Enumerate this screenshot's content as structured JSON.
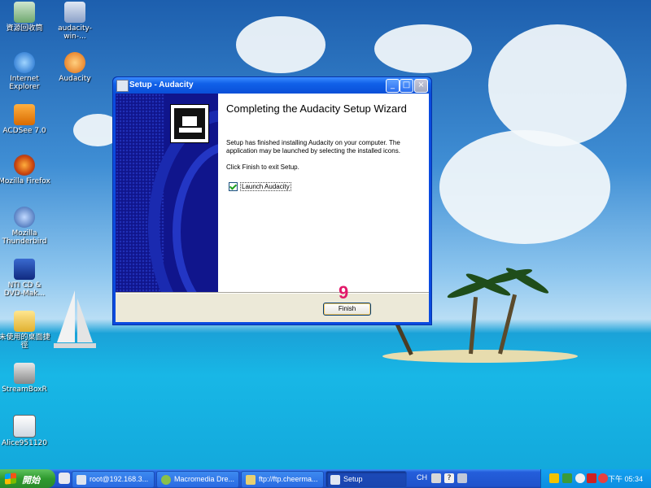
{
  "desktop": {
    "icons": [
      {
        "label": "資源回收筒"
      },
      {
        "label": "audacity-win-..."
      },
      {
        "label": "Internet Explorer"
      },
      {
        "label": "Audacity"
      },
      {
        "label": "ACDSee 7.0"
      },
      {
        "label": "Mozilla Firefox"
      },
      {
        "label": "Mozilla Thunderbird"
      },
      {
        "label": "NTI CD & DVD-Mak..."
      },
      {
        "label": "未使用的桌面捷徑"
      },
      {
        "label": "StreamBoxR"
      },
      {
        "label": "Alice951120"
      }
    ]
  },
  "window": {
    "title": "Setup - Audacity",
    "heading": "Completing the Audacity Setup Wizard",
    "description": "Setup has finished installing Audacity on your computer. The application may be launched by selecting the installed icons.",
    "instruction": "Click Finish to exit Setup.",
    "checkbox_label": "Launch Audacity",
    "checkbox_checked": true,
    "finish_label": "Finish",
    "step_number": "9"
  },
  "taskbar": {
    "start_label": "開始",
    "tasks": [
      {
        "label": "root@192.168.3..."
      },
      {
        "label": "Macromedia Dre..."
      },
      {
        "label": "ftp://ftp.cheerma..."
      },
      {
        "label": "Setup"
      }
    ],
    "language": "CH",
    "clock": "下午 05:34"
  },
  "colors": {
    "accent": "#0a4be0",
    "step_marker": "#e21a6a",
    "start_green": "#2f9a2f"
  }
}
